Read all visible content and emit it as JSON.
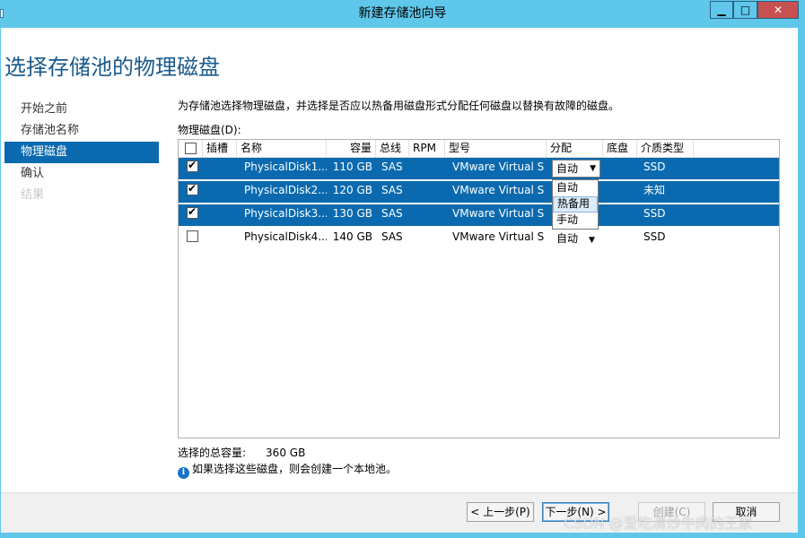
{
  "window": {
    "title": "新建存储池向导"
  },
  "page": {
    "title": "选择存储池的物理磁盘"
  },
  "nav": {
    "items": [
      {
        "label": "开始之前",
        "state": "normal"
      },
      {
        "label": "存储池名称",
        "state": "normal"
      },
      {
        "label": "物理磁盘",
        "state": "active"
      },
      {
        "label": "确认",
        "state": "normal"
      },
      {
        "label": "结果",
        "state": "disabled"
      }
    ]
  },
  "content": {
    "description": "为存储池选择物理磁盘，并选择是否应以热备用磁盘形式分配任何磁盘以替换有故障的磁盘。",
    "list_label": "物理磁盘(D):",
    "columns": [
      "插槽",
      "名称",
      "容量",
      "总线",
      "RPM",
      "型号",
      "分配",
      "底盘",
      "介质类型"
    ],
    "rows": [
      {
        "checked": true,
        "slot": "",
        "name": "PhysicalDisk1...",
        "capacity": "110 GB",
        "bus": "SAS",
        "rpm": "",
        "model": "VMware Virtual S",
        "allocation": "自动",
        "chassis": "",
        "media": "SSD",
        "selected": true
      },
      {
        "checked": true,
        "slot": "",
        "name": "PhysicalDisk2...",
        "capacity": "120 GB",
        "bus": "SAS",
        "rpm": "",
        "model": "VMware Virtual S",
        "allocation": "",
        "chassis": "",
        "media": "未知",
        "selected": true
      },
      {
        "checked": true,
        "slot": "",
        "name": "PhysicalDisk3...",
        "capacity": "130 GB",
        "bus": "SAS",
        "rpm": "",
        "model": "VMware Virtual S",
        "allocation": "",
        "chassis": "",
        "media": "SSD",
        "selected": true
      },
      {
        "checked": false,
        "slot": "",
        "name": "PhysicalDisk4...",
        "capacity": "140 GB",
        "bus": "SAS",
        "rpm": "",
        "model": "VMware Virtual S",
        "allocation": "自动",
        "chassis": "",
        "media": "SSD",
        "selected": false
      }
    ],
    "dropdown_options": [
      "自动",
      "热备用",
      "手动"
    ],
    "dropdown_hover": "热备用",
    "summary_label": "选择的总容量:",
    "summary_value": "360 GB",
    "info_icon": "info-icon",
    "info_text": "如果选择这些磁盘，则会创建一个本地池。"
  },
  "buttons": {
    "prev": "< 上一步(P)",
    "next": "下一步(N) >",
    "create": "创建(C)",
    "cancel": "取消"
  },
  "window_buttons": {
    "minimize": "▁",
    "maximize": "□",
    "close": "✕"
  },
  "watermark": "CSDN @爱吃清炒牛肉的王家",
  "colors": {
    "titlebar": "#5ec7ea",
    "selection": "#0b6aaf",
    "title_text": "#1a5a8c"
  }
}
